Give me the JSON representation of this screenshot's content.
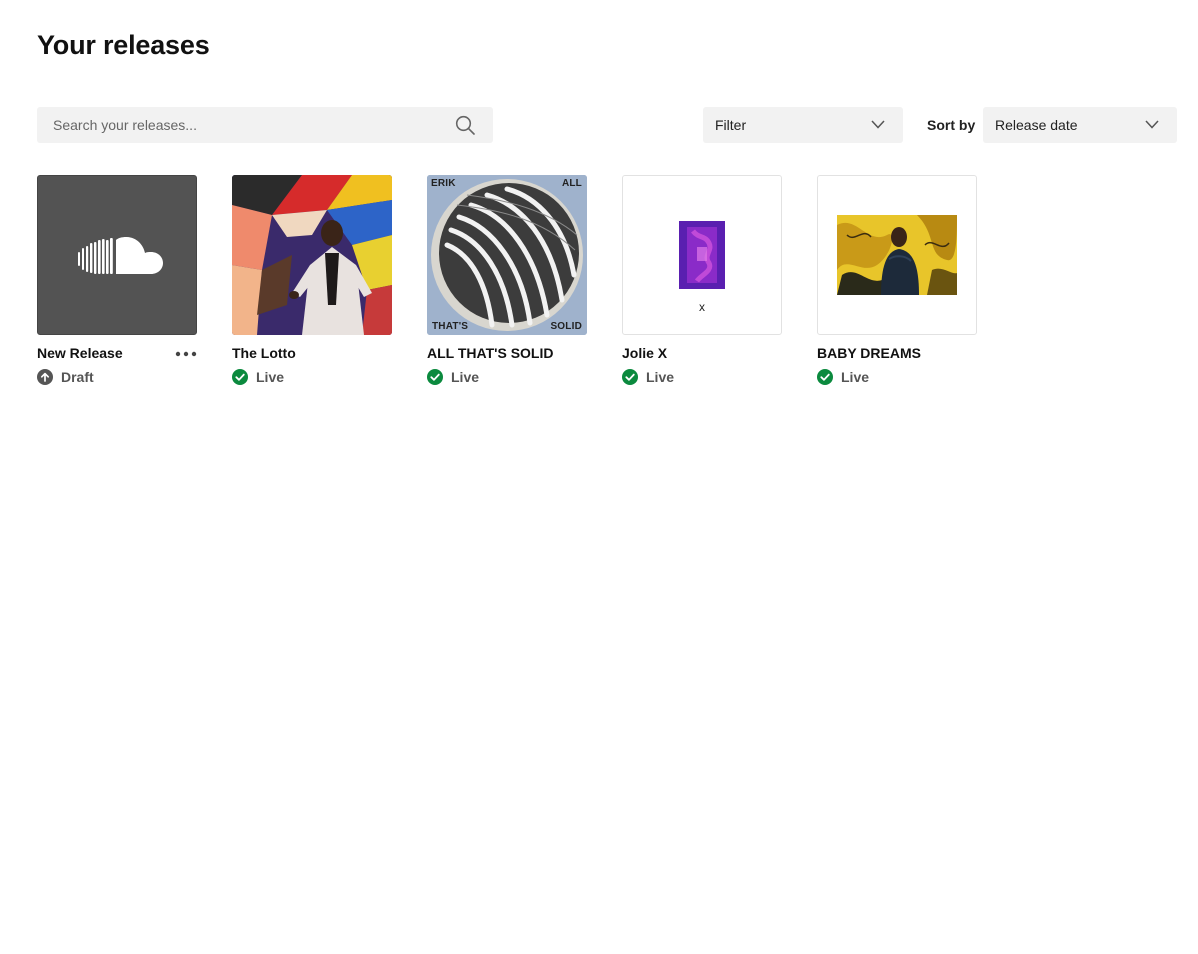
{
  "page": {
    "title": "Your releases"
  },
  "search": {
    "placeholder": "Search your releases..."
  },
  "filter": {
    "label": "Filter"
  },
  "sort": {
    "label": "Sort by",
    "value": "Release date"
  },
  "colors": {
    "live": "#0b8a3e",
    "draft": "#555555",
    "panel": "#f2f2f2",
    "new_release_bg": "#535353"
  },
  "releases": [
    {
      "title": "New Release",
      "status": "Draft",
      "status_icon": "upload-circle-icon",
      "art_icon": "soundcloud-logo-icon"
    },
    {
      "title": "The Lotto",
      "status": "Live",
      "status_icon": "check-circle-icon"
    },
    {
      "title": "ALL THAT'S SOLID",
      "status": "Live",
      "status_icon": "check-circle-icon",
      "art_text": {
        "top_left": "ERIK",
        "top_right": "ALL",
        "bottom_left": "THAT'S",
        "bottom_right": "SOLID"
      }
    },
    {
      "title": "Jolie X",
      "status": "Live",
      "status_icon": "check-circle-icon",
      "art_caption": "x"
    },
    {
      "title": "BABY DREAMS",
      "status": "Live",
      "status_icon": "check-circle-icon"
    }
  ]
}
